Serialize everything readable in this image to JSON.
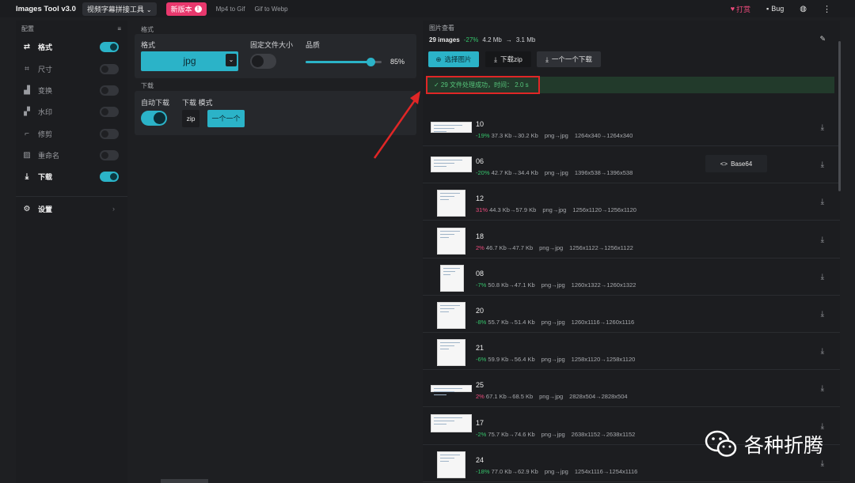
{
  "topbar": {
    "brand": "Images Tool v3.0",
    "tool_select": "视频字幕拼接工具",
    "new_version": "新版本",
    "link_mp4": "Mp4 to Gif",
    "link_gif": "Gif to Webp",
    "donate": "打赏",
    "bug": "Bug",
    "icons": [
      "chevron-down-icon",
      "alert-icon",
      "heart-icon",
      "chat-icon",
      "globe-icon",
      "more-vertical-icon"
    ]
  },
  "sidebar": {
    "title": "配置",
    "items": [
      {
        "label": "格式",
        "icon": "swap-icon",
        "active": true,
        "on": true
      },
      {
        "label": "尺寸",
        "icon": "crop-icon",
        "active": false,
        "on": false
      },
      {
        "label": "变换",
        "icon": "transform-icon",
        "active": false,
        "on": false
      },
      {
        "label": "水印",
        "icon": "watermark-icon",
        "active": false,
        "on": false
      },
      {
        "label": "修剪",
        "icon": "trim-icon",
        "active": false,
        "on": false
      },
      {
        "label": "重命名",
        "icon": "rename-icon",
        "active": false,
        "on": false
      },
      {
        "label": "下载",
        "icon": "download-icon",
        "active": true,
        "on": true
      }
    ],
    "settings_label": "设置"
  },
  "format_section": {
    "title": "格式",
    "format_label": "格式",
    "format_value": "jpg",
    "fixed_size_label": "固定文件大小",
    "quality_label": "品质",
    "quality_value": "85%",
    "quality_fraction": 0.85
  },
  "download_section": {
    "title": "下载",
    "auto_label": "自动下载",
    "mode_label": "下载 模式",
    "mode_zip": "zip",
    "mode_one": "一个一个"
  },
  "viewer": {
    "title": "图片查看",
    "count": "29 images",
    "pct": "-27%",
    "size_from": "4.2 Mb",
    "arrow": "→",
    "size_to": "3.1 Mb",
    "btn_select": "选择图片",
    "btn_zip": "下载zip",
    "btn_one": "一个一个下载",
    "success": "✓ 29 文件处理成功，时间： 2.0 s",
    "base64": "Base64",
    "rows": [
      {
        "name": "10",
        "pct": "-19%",
        "sign": "neg",
        "sizes": "37.3 Kb→30.2 Kb",
        "conv": "png→jpg",
        "dims": "1264x340→1264x340"
      },
      {
        "name": "06",
        "pct": "-20%",
        "sign": "neg",
        "sizes": "42.7 Kb→34.4 Kb",
        "conv": "png→jpg",
        "dims": "1396x538→1396x538"
      },
      {
        "name": "12",
        "pct": "31%",
        "sign": "pos",
        "sizes": "44.3 Kb→57.9 Kb",
        "conv": "png→jpg",
        "dims": "1256x1120→1256x1120"
      },
      {
        "name": "18",
        "pct": "2%",
        "sign": "pos",
        "sizes": "46.7 Kb→47.7 Kb",
        "conv": "png→jpg",
        "dims": "1256x1122→1256x1122"
      },
      {
        "name": "08",
        "pct": "-7%",
        "sign": "neg",
        "sizes": "50.8 Kb→47.1 Kb",
        "conv": "png→jpg",
        "dims": "1260x1322→1260x1322"
      },
      {
        "name": "20",
        "pct": "-8%",
        "sign": "neg",
        "sizes": "55.7 Kb→51.4 Kb",
        "conv": "png→jpg",
        "dims": "1260x1116→1260x1116"
      },
      {
        "name": "21",
        "pct": "-6%",
        "sign": "neg",
        "sizes": "59.9 Kb→56.4 Kb",
        "conv": "png→jpg",
        "dims": "1258x1120→1258x1120"
      },
      {
        "name": "25",
        "pct": "2%",
        "sign": "pos",
        "sizes": "67.1 Kb→68.5 Kb",
        "conv": "png→jpg",
        "dims": "2828x504→2828x504"
      },
      {
        "name": "17",
        "pct": "-2%",
        "sign": "neg",
        "sizes": "75.7 Kb→74.6 Kb",
        "conv": "png→jpg",
        "dims": "2638x1152→2638x1152"
      },
      {
        "name": "24",
        "pct": "-18%",
        "sign": "neg",
        "sizes": "77.0 Kb→62.9 Kb",
        "conv": "png→jpg",
        "dims": "1254x1116→1254x1116"
      }
    ]
  },
  "watermark": {
    "text": "各种折腾",
    "icon": "wechat-icon"
  },
  "colors": {
    "accent": "#2bb3c8",
    "pink": "#e8386d",
    "green": "#35c46b",
    "red_box": "#e02626"
  }
}
